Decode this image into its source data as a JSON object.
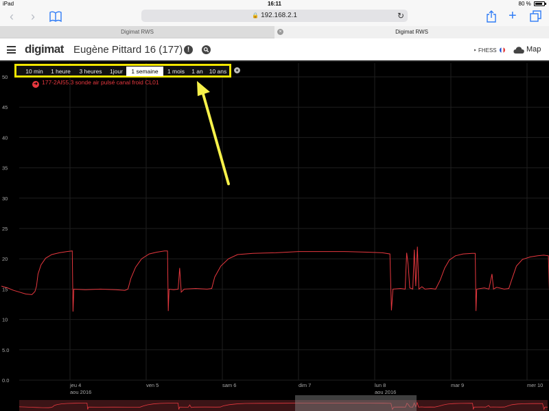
{
  "status_bar": {
    "device": "iPad",
    "time": "16:11",
    "battery": "80 %"
  },
  "browser": {
    "url": "192.168.2.1",
    "tabs": [
      {
        "title": "Digimat RWS"
      },
      {
        "title": "Digimat RWS"
      }
    ]
  },
  "header": {
    "logo": "digimat",
    "site_title": "Eugène Pittard 16 (177)",
    "user_label": "FHESS",
    "map_label": "Map"
  },
  "range_selector": {
    "options": [
      "10 min",
      "1 heure",
      "3 heures",
      "1jour",
      "1 semaine",
      "1 mois",
      "1 an",
      "10 ans"
    ],
    "active": "1 semaine"
  },
  "legend": {
    "series_label": "177-2AI55.3  sonde air pulsé canal froid CL01"
  },
  "colors": {
    "series": "#e8383f",
    "highlight_box": "#f2e600",
    "annotation_arrow": "#f7f14a"
  },
  "chart_data": {
    "type": "line",
    "title": "",
    "xlabel": "",
    "ylabel": "",
    "ylim": [
      0,
      50
    ],
    "y_ticks": [
      "0.0",
      "5.0",
      "10",
      "15",
      "20",
      "25",
      "30",
      "35",
      "40",
      "45",
      "50"
    ],
    "x_ticks": [
      {
        "label": "jeu 4",
        "sub": "aou 2016",
        "day": 1
      },
      {
        "label": "ven 5",
        "sub": "",
        "day": 2
      },
      {
        "label": "sam 6",
        "sub": "",
        "day": 3
      },
      {
        "label": "dim 7",
        "sub": "",
        "day": 4
      },
      {
        "label": "lun 8",
        "sub": "aou 2016",
        "day": 5
      },
      {
        "label": "mar 9",
        "sub": "",
        "day": 6
      },
      {
        "label": "mer 10",
        "sub": "",
        "day": 7
      }
    ],
    "xlim_days": [
      0.1,
      7.35
    ],
    "grid": true,
    "series": [
      {
        "name": "177-2AI55.3  sonde air pulsé canal froid CL01",
        "points": [
          [
            0.1,
            15.5
          ],
          [
            0.18,
            15.2
          ],
          [
            0.26,
            14.8
          ],
          [
            0.34,
            14.5
          ],
          [
            0.42,
            14.2
          ],
          [
            0.5,
            14.1
          ],
          [
            0.54,
            14.6
          ],
          [
            0.56,
            15.5
          ],
          [
            0.58,
            17.5
          ],
          [
            0.62,
            19.0
          ],
          [
            0.68,
            20.1
          ],
          [
            0.76,
            20.7
          ],
          [
            0.86,
            21.0
          ],
          [
            0.96,
            21.2
          ],
          [
            1.03,
            21.3
          ],
          [
            1.04,
            11.3
          ],
          [
            1.05,
            15.0
          ],
          [
            1.2,
            14.9
          ],
          [
            1.4,
            15.0
          ],
          [
            1.6,
            14.9
          ],
          [
            1.72,
            14.8
          ],
          [
            1.76,
            15.0
          ],
          [
            1.8,
            16.8
          ],
          [
            1.86,
            18.6
          ],
          [
            1.94,
            20.0
          ],
          [
            2.04,
            20.8
          ],
          [
            2.14,
            21.1
          ],
          [
            2.24,
            21.3
          ],
          [
            2.28,
            21.3
          ],
          [
            2.29,
            11.4
          ],
          [
            2.3,
            15.0
          ],
          [
            2.36,
            14.9
          ],
          [
            2.42,
            15.0
          ],
          [
            2.44,
            18.5
          ],
          [
            2.46,
            14.5
          ],
          [
            2.5,
            15.0
          ],
          [
            2.65,
            15.1
          ],
          [
            2.8,
            15.0
          ],
          [
            2.86,
            15.1
          ],
          [
            2.9,
            17.0
          ],
          [
            2.98,
            18.8
          ],
          [
            3.08,
            20.0
          ],
          [
            3.2,
            20.7
          ],
          [
            3.4,
            20.9
          ],
          [
            3.7,
            21.0
          ],
          [
            4.0,
            21.2
          ],
          [
            4.3,
            21.2
          ],
          [
            4.6,
            21.2
          ],
          [
            4.9,
            21.1
          ],
          [
            5.1,
            21.0
          ],
          [
            5.2,
            20.8
          ],
          [
            5.22,
            11.5
          ],
          [
            5.24,
            15.0
          ],
          [
            5.34,
            15.1
          ],
          [
            5.4,
            15.0
          ],
          [
            5.42,
            21.0
          ],
          [
            5.44,
            19.0
          ],
          [
            5.46,
            15.2
          ],
          [
            5.5,
            15.0
          ],
          [
            5.52,
            21.5
          ],
          [
            5.54,
            15.5
          ],
          [
            5.56,
            22.0
          ],
          [
            5.58,
            15.0
          ],
          [
            5.62,
            15.4
          ],
          [
            5.66,
            15.0
          ],
          [
            5.74,
            15.1
          ],
          [
            5.8,
            15.0
          ],
          [
            5.86,
            16.5
          ],
          [
            5.92,
            18.5
          ],
          [
            5.98,
            19.8
          ],
          [
            6.06,
            20.5
          ],
          [
            6.16,
            20.8
          ],
          [
            6.28,
            20.9
          ],
          [
            6.32,
            20.9
          ],
          [
            6.33,
            11.4
          ],
          [
            6.34,
            15.0
          ],
          [
            6.44,
            15.2
          ],
          [
            6.5,
            15.0
          ],
          [
            6.54,
            17.5
          ],
          [
            6.56,
            15.0
          ],
          [
            6.6,
            15.3
          ],
          [
            6.7,
            15.0
          ],
          [
            6.76,
            15.1
          ],
          [
            6.8,
            16.6
          ],
          [
            6.86,
            18.8
          ],
          [
            6.94,
            19.9
          ],
          [
            7.04,
            20.3
          ],
          [
            7.14,
            20.5
          ],
          [
            7.22,
            20.6
          ],
          [
            7.28,
            20.5
          ],
          [
            7.3,
            11.4
          ],
          [
            7.31,
            15.0
          ],
          [
            7.35,
            15.0
          ]
        ]
      }
    ]
  }
}
